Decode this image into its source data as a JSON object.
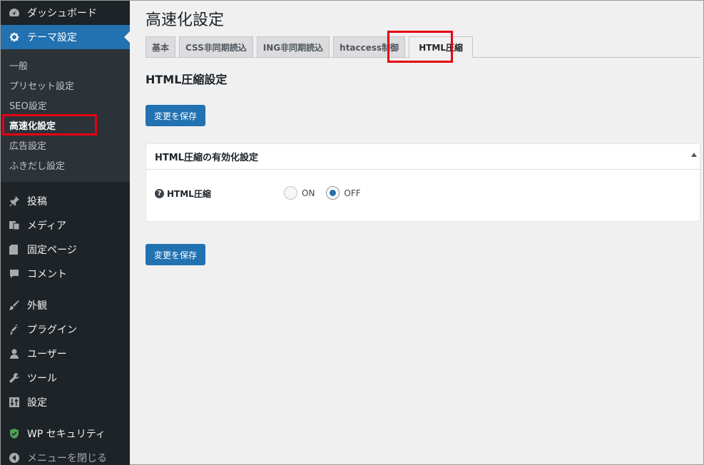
{
  "sidebar": {
    "top_items": [
      {
        "label": "ダッシュボード",
        "icon": "dashboard-icon"
      },
      {
        "label": "テーマ設定",
        "icon": "gear-icon",
        "current": true
      }
    ],
    "submenu": [
      {
        "label": "一般"
      },
      {
        "label": "プリセット設定"
      },
      {
        "label": "SEO設定"
      },
      {
        "label": "高速化設定",
        "active": true
      },
      {
        "label": "広告設定"
      },
      {
        "label": "ふきだし設定"
      }
    ],
    "items_a": [
      {
        "label": "投稿",
        "icon": "pin-icon"
      },
      {
        "label": "メディア",
        "icon": "media-icon"
      },
      {
        "label": "固定ページ",
        "icon": "page-icon"
      },
      {
        "label": "コメント",
        "icon": "comment-icon"
      }
    ],
    "items_b": [
      {
        "label": "外観",
        "icon": "brush-icon"
      },
      {
        "label": "プラグイン",
        "icon": "plugin-icon"
      },
      {
        "label": "ユーザー",
        "icon": "user-icon"
      },
      {
        "label": "ツール",
        "icon": "wrench-icon"
      },
      {
        "label": "設定",
        "icon": "settings-icon"
      }
    ],
    "items_c": [
      {
        "label": "WP セキュリティ",
        "icon": "shield-icon"
      },
      {
        "label": "メニューを閉じる",
        "icon": "collapse-icon"
      }
    ]
  },
  "main": {
    "title": "高速化設定",
    "tabs": [
      "基本",
      "CSS非同期読込",
      "ING非同期読込",
      "htaccess制御",
      "HTML圧縮"
    ],
    "active_tab": 4,
    "section_title": "HTML圧縮設定",
    "save_label": "変更を保存",
    "panel": {
      "title": "HTML圧縮の有効化設定",
      "field_label": "HTML圧縮",
      "options": [
        "ON",
        "OFF"
      ],
      "selected": "OFF"
    }
  },
  "colors": {
    "highlight": "#e60012",
    "accent": "#2271b1",
    "sidebar": "#1d2327"
  }
}
